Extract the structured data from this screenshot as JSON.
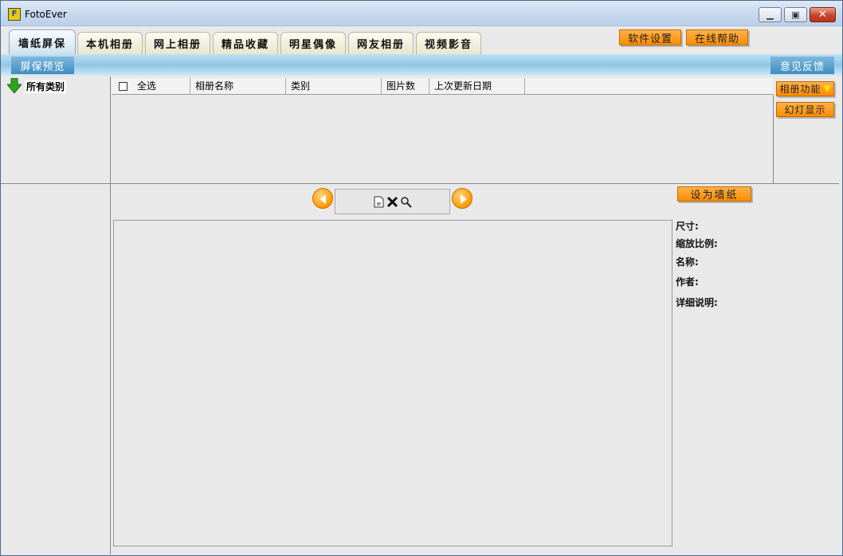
{
  "window": {
    "title": "FotoEver",
    "app_icon_letter": "F"
  },
  "tabs": [
    {
      "label": "墙纸屏保",
      "active": true
    },
    {
      "label": "本机相册",
      "active": false
    },
    {
      "label": "网上相册",
      "active": false
    },
    {
      "label": "精品收藏",
      "active": false
    },
    {
      "label": "明星偶像",
      "active": false
    },
    {
      "label": "网友相册",
      "active": false
    },
    {
      "label": "视频影音",
      "active": false
    }
  ],
  "top_buttons": {
    "settings": "软件设置",
    "help": "在线帮助"
  },
  "strip": {
    "preview": "屏保预览",
    "feedback": "意见反馈"
  },
  "tree": {
    "root": "所有类别"
  },
  "list": {
    "columns": [
      "全选",
      "相册名称",
      "类别",
      "图片数",
      "上次更新日期"
    ]
  },
  "side": {
    "album_func": "相册功能",
    "slideshow": "幻灯显示"
  },
  "viewer": {
    "set_wallpaper": "设为墙纸"
  },
  "info": {
    "size": "尺寸:",
    "zoom": "缩放比例:",
    "name": "名称:",
    "author": "作者:",
    "detail": "详细说明:"
  },
  "colors": {
    "accent_orange": "#ff8c00",
    "strip_blue": "#8fc6e6"
  },
  "icons": [
    "app-icon",
    "minimize-icon",
    "maximize-icon",
    "close-icon",
    "green-down-arrow-icon",
    "prev-arrow-icon",
    "next-arrow-icon",
    "page-icon",
    "delete-icon",
    "magnify-icon",
    "dropdown-triangle-icon"
  ]
}
